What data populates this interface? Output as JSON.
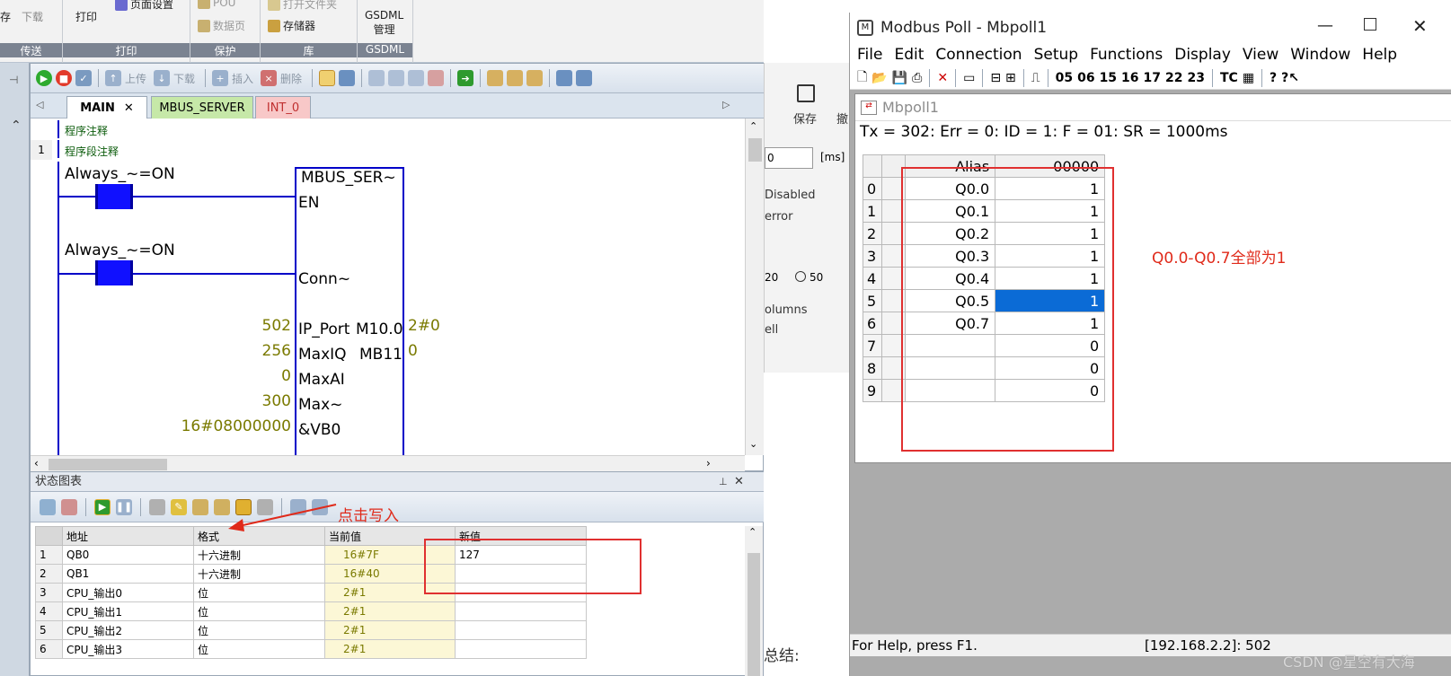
{
  "ribbon": {
    "groups": [
      {
        "title": "传送",
        "items": [
          "存",
          "下载"
        ]
      },
      {
        "title": "打印",
        "items": [
          "打印",
          "页面设置"
        ]
      },
      {
        "title": "保护",
        "items": [
          "POU",
          "数据页"
        ]
      },
      {
        "title": "库",
        "items": [
          "打开文件夹",
          "存储器"
        ]
      },
      {
        "title": "GSDML",
        "items": [
          "GSDML",
          "管理"
        ]
      }
    ]
  },
  "editor": {
    "toolbar": {
      "upload": "上传",
      "download": "下载",
      "insert": "插入",
      "delete": "删除"
    },
    "tabs": [
      "MAIN",
      "MBUS_SERVER",
      "INT_0"
    ],
    "program_comment": "程序注释",
    "network_number": "1",
    "network_comment": "程序段注释",
    "contact1": "Always_~=ON",
    "contact2": "Always_~=ON",
    "block": {
      "name": "MBUS_SER~",
      "en": "EN",
      "conn": "Conn~",
      "pins": [
        {
          "value": "502",
          "in": "IP_Port",
          "out": "M10.0",
          "outval": "2#0"
        },
        {
          "value": "256",
          "in": "MaxIQ",
          "out": "MB11",
          "outval": "0"
        },
        {
          "value": "0",
          "in": "MaxAI",
          "out": "",
          "outval": ""
        },
        {
          "value": "300",
          "in": "Max~",
          "out": "",
          "outval": ""
        },
        {
          "value": "16#08000000",
          "in": "&VB0",
          "out": "",
          "outval": ""
        }
      ]
    }
  },
  "status_chart": {
    "title": "状态图表",
    "columns": [
      "地址",
      "格式",
      "当前值",
      "新值"
    ],
    "rows": [
      [
        "1",
        "QB0",
        "十六进制",
        "16#7F",
        "127"
      ],
      [
        "2",
        "QB1",
        "十六进制",
        "16#40",
        ""
      ],
      [
        "3",
        "CPU_输出0",
        "位",
        "2#1",
        ""
      ],
      [
        "4",
        "CPU_输出1",
        "位",
        "2#1",
        ""
      ],
      [
        "5",
        "CPU_输出2",
        "位",
        "2#1",
        ""
      ],
      [
        "6",
        "CPU_输出3",
        "位",
        "2#1",
        ""
      ]
    ],
    "annotation": "点击写入"
  },
  "middle": {
    "save_label": "保存",
    "undo_label": "撤",
    "ms_unit": "[ms]",
    "input_value": "0",
    "disabled": "Disabled",
    "error": "error",
    "radio_20": "20",
    "radio_50": "50",
    "columns": "olumns",
    "cell": "ell",
    "summary": "总结:"
  },
  "modbus": {
    "title": "Modbus Poll - Mbpoll1",
    "menu": [
      "File",
      "Edit",
      "Connection",
      "Setup",
      "Functions",
      "Display",
      "View",
      "Window",
      "Help"
    ],
    "toolbar_codes": [
      "05",
      "06",
      "15",
      "16",
      "17",
      "22",
      "23",
      "TC"
    ],
    "child_title": "Mbpoll1",
    "tx_line": "Tx = 302: Err = 0: ID = 1: F = 01: SR = 1000ms",
    "col_alias": "Alias",
    "col_addr": "00000",
    "rows": [
      {
        "idx": "0",
        "alias": "Q0.0",
        "value": "1"
      },
      {
        "idx": "1",
        "alias": "Q0.1",
        "value": "1"
      },
      {
        "idx": "2",
        "alias": "Q0.2",
        "value": "1"
      },
      {
        "idx": "3",
        "alias": "Q0.3",
        "value": "1"
      },
      {
        "idx": "4",
        "alias": "Q0.4",
        "value": "1"
      },
      {
        "idx": "5",
        "alias": "Q0.5",
        "value": "1"
      },
      {
        "idx": "6",
        "alias": "Q0.7",
        "value": "1"
      },
      {
        "idx": "7",
        "alias": "",
        "value": "0"
      },
      {
        "idx": "8",
        "alias": "",
        "value": "0"
      },
      {
        "idx": "9",
        "alias": "",
        "value": "0"
      }
    ],
    "annotation": "Q0.0-Q0.7全部为1",
    "status_help": "For Help, press F1.",
    "status_conn": "[192.168.2.2]: 502"
  },
  "watermark": "CSDN @星空有大海",
  "colors": {
    "annotation_red": "#e02a1a",
    "selection_blue": "#0b6bd6",
    "ladder_blue": "#0000c8"
  }
}
